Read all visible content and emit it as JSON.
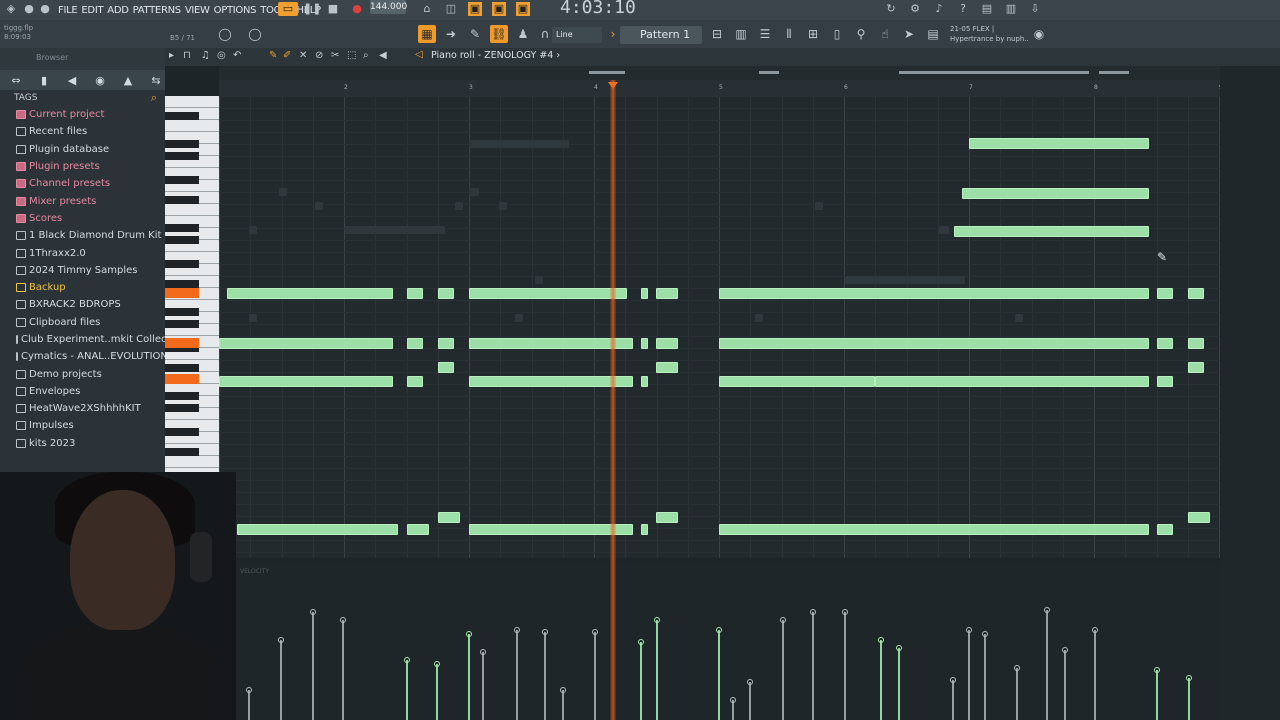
{
  "menu": [
    "FILE",
    "EDIT",
    "ADD",
    "PATTERNS",
    "VIEW",
    "OPTIONS",
    "TOOLS",
    "HELP"
  ],
  "transport": {
    "tempo": "144.000",
    "time": "4:03:10"
  },
  "project": {
    "name": "tiggg.flp",
    "position": "8:09:03",
    "hint": "B5 / 71"
  },
  "toolbar": {
    "snap": "Line",
    "pattern": "Pattern 1"
  },
  "plugin_info": {
    "line1": "21-05 FLEX |",
    "line2": "Hypertrance by nuph.."
  },
  "piano_roll": {
    "title": "Piano roll - ZENOLOGY #4 ›"
  },
  "browser": {
    "header": "Browser",
    "tags_label": "TAGS",
    "items": [
      {
        "label": "Current project",
        "style": "pink"
      },
      {
        "label": "Recent files",
        "style": "plain"
      },
      {
        "label": "Plugin database",
        "style": "plain"
      },
      {
        "label": "Plugin presets",
        "style": "pink"
      },
      {
        "label": "Channel presets",
        "style": "pink"
      },
      {
        "label": "Mixer presets",
        "style": "pink"
      },
      {
        "label": "Scores",
        "style": "pink"
      },
      {
        "label": "1 Black Diamond Drum Kit",
        "style": "plain"
      },
      {
        "label": "1Thraxx2.0",
        "style": "plain"
      },
      {
        "label": "2024 Timmy Samples",
        "style": "plain"
      },
      {
        "label": "Backup",
        "style": "yellow"
      },
      {
        "label": "BXRACK2 BDROPS",
        "style": "plain"
      },
      {
        "label": "Clipboard files",
        "style": "plain"
      },
      {
        "label": "Club Experiment..mkit Collection",
        "style": "plain"
      },
      {
        "label": "Cymatics - ANAL..EVOLUTION Beta",
        "style": "plain"
      },
      {
        "label": "Demo projects",
        "style": "plain"
      },
      {
        "label": "Envelopes",
        "style": "plain"
      },
      {
        "label": "HeatWave2XShhhhKIT",
        "style": "plain"
      },
      {
        "label": "Impulses",
        "style": "plain"
      },
      {
        "label": "kits 2023",
        "style": "plain"
      }
    ]
  },
  "ruler": {
    "bars": [
      "2",
      "3",
      "4",
      "5",
      "6",
      "7",
      "8",
      "9"
    ]
  },
  "velocity_label": "VELOCITY"
}
